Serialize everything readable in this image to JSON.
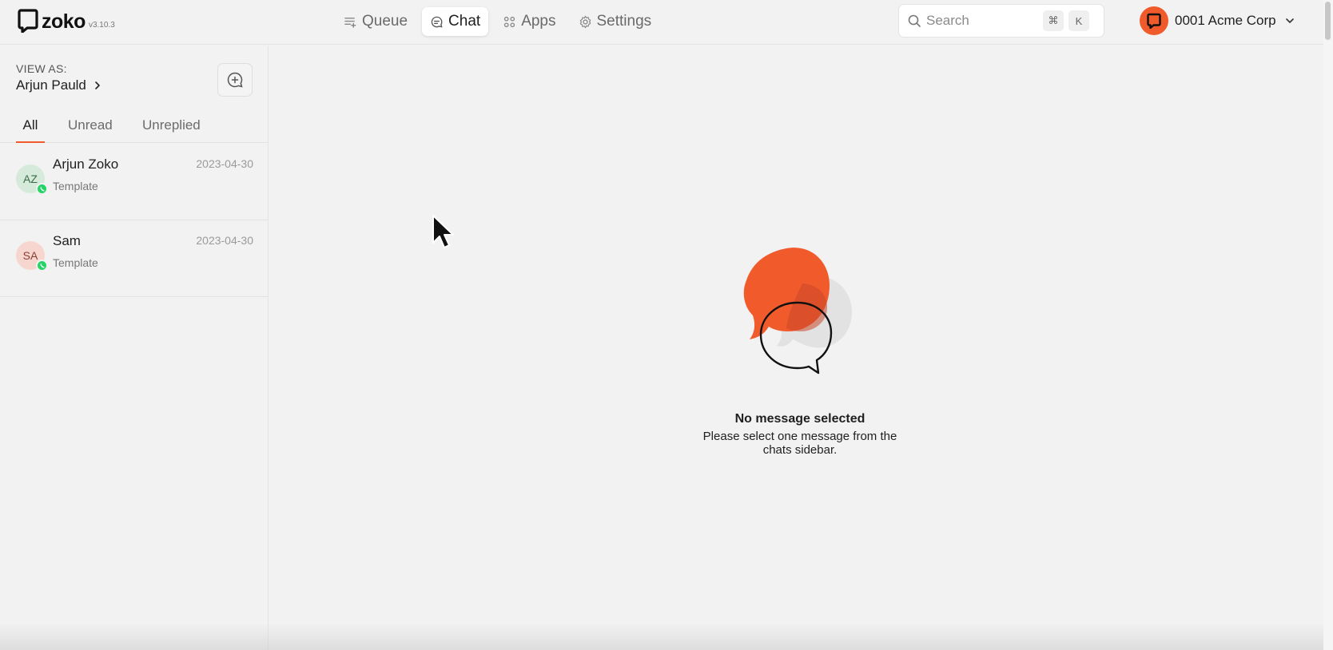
{
  "header": {
    "logo_word": "zoko",
    "version": "v3.10.3",
    "nav": [
      {
        "label": "Queue",
        "icon": "queue-icon"
      },
      {
        "label": "Chat",
        "icon": "chat-icon"
      },
      {
        "label": "Apps",
        "icon": "apps-icon"
      },
      {
        "label": "Settings",
        "icon": "gear-icon"
      }
    ],
    "search": {
      "placeholder": "Search",
      "kbd": [
        "⌘",
        "K"
      ]
    },
    "org": {
      "name": "0001 Acme Corp"
    }
  },
  "sidebar": {
    "view_as_label": "VIEW AS:",
    "view_as_name": "Arjun Pauld",
    "tabs": [
      "All",
      "Unread",
      "Unreplied"
    ],
    "chats": [
      {
        "initials": "AZ",
        "name": "Arjun Zoko",
        "subtitle": "Template",
        "date": "2023-04-30"
      },
      {
        "initials": "SA",
        "name": "Sam",
        "subtitle": "Template",
        "date": "2023-04-30"
      }
    ]
  },
  "main": {
    "empty_title": "No message selected",
    "empty_subtitle": "Please select one message from the chats sidebar."
  },
  "colors": {
    "accent": "#f15a2b",
    "whatsapp": "#25d366"
  }
}
